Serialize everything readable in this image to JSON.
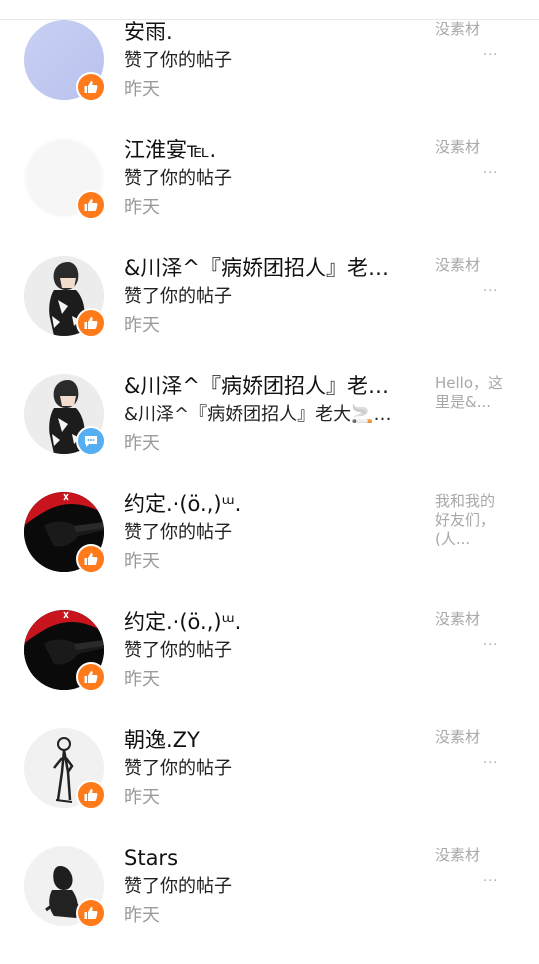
{
  "colors": {
    "like_badge": "#ff7a1a",
    "comment_badge": "#56aef2",
    "muted_text": "#9a9a9a",
    "preview_text": "#a8a8a8"
  },
  "notifications": [
    {
      "name": "安雨.",
      "action": "赞了你的帖子",
      "time": "昨天",
      "preview": "没素材",
      "preview_more": "...",
      "badge_icon": "thumbs-up-icon",
      "avatar": "lavender-circle"
    },
    {
      "name": "江淮宴℡.",
      "action": "赞了你的帖子",
      "time": "昨天",
      "preview": "没素材",
      "preview_more": "...",
      "badge_icon": "thumbs-up-icon",
      "avatar": "blank-white"
    },
    {
      "name": "&川泽^『病娇团招人』老…",
      "action": "赞了你的帖子",
      "time": "昨天",
      "preview": "没素材",
      "preview_more": "...",
      "badge_icon": "thumbs-up-icon",
      "avatar": "anime-boy"
    },
    {
      "name": "&川泽^『病娇团招人』老…",
      "action": "&川泽^『病娇团招人』老大🚬…",
      "time": "昨天",
      "preview": "Hello，这里是&...",
      "preview_more": "",
      "badge_icon": "comment-icon",
      "avatar": "anime-boy"
    },
    {
      "name": "约定.·(ö.,)ᵚ.",
      "action": "赞了你的帖子",
      "time": "昨天",
      "preview": "我和我的好友们，(人...",
      "preview_more": "",
      "badge_icon": "thumbs-up-icon",
      "avatar": "red-black-silhouette"
    },
    {
      "name": "约定.·(ö.,)ᵚ.",
      "action": "赞了你的帖子",
      "time": "昨天",
      "preview": "没素材",
      "preview_more": "...",
      "badge_icon": "thumbs-up-icon",
      "avatar": "red-black-silhouette"
    },
    {
      "name": "朝逸.ZY",
      "action": "赞了你的帖子",
      "time": "昨天",
      "preview": "没素材",
      "preview_more": "...",
      "badge_icon": "thumbs-up-icon",
      "avatar": "standing-sketch"
    },
    {
      "name": "Stars",
      "action": "赞了你的帖子",
      "time": "昨天",
      "preview": "没素材",
      "preview_more": "...",
      "badge_icon": "thumbs-up-icon",
      "avatar": "sitting-sketch"
    }
  ]
}
